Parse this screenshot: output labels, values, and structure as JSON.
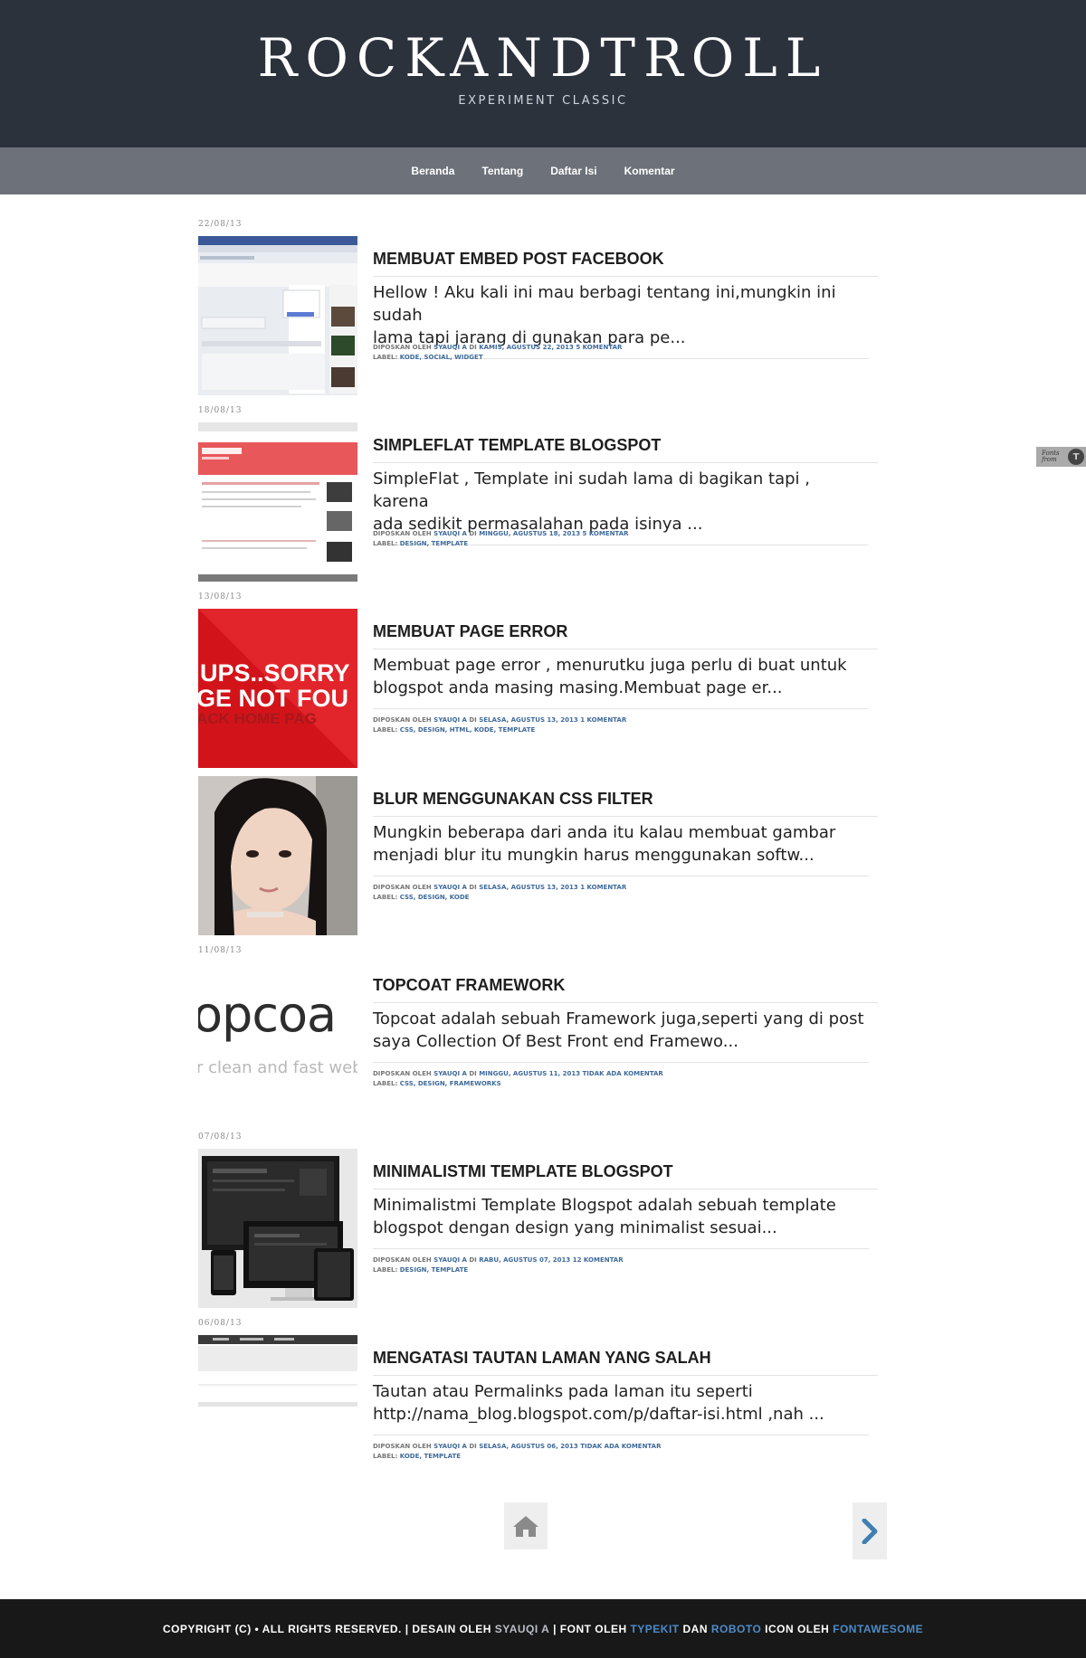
{
  "header": {
    "title": "ROCKANDTROLL",
    "subtitle": "EXPERIMENT CLASSIC"
  },
  "nav": {
    "items": [
      "Beranda",
      "Tentang",
      "Daftar Isi",
      "Komentar"
    ]
  },
  "meta_labels": {
    "posted_by": "Diposkan oleh",
    "at": "di",
    "label": "Label:"
  },
  "posts": [
    {
      "date": "22/08/13",
      "title": "Membuat Embed Post Facebook",
      "excerpt_line1": "Hellow ! Aku kali ini mau berbagi tentang ini,mungkin ini sudah",
      "excerpt_line2": "lama tapi jarang di gunakan para pe...",
      "author": "Syauqi A",
      "timestamp": "Kamis, Agustus 22, 2013",
      "comments": "5 komentar",
      "labels": "Kode, Social, Widget"
    },
    {
      "date": "18/08/13",
      "title": "SimpleFlat Template Blogspot",
      "excerpt_line1": "SimpleFlat , Template ini sudah lama di bagikan tapi , karena",
      "excerpt_line2": "ada sedikit permasalahan pada isinya ...",
      "author": "Syauqi A",
      "timestamp": "Minggu, Agustus 18, 2013",
      "comments": "5 komentar",
      "labels": "Design, Template"
    },
    {
      "date": "13/08/13",
      "title": "Membuat Page Error",
      "excerpt_line1": "Membuat page error , menurutku juga perlu di buat untuk",
      "excerpt_line2": "blogspot anda masing masing.Membuat page er...",
      "author": "Syauqi A",
      "timestamp": "Selasa, Agustus 13, 2013",
      "comments": "1 komentar",
      "labels": "Css, Design, Html, Kode, Template",
      "thumb_text1": "UPS..SORRY",
      "thumb_text2": "GE NOT FOU",
      "thumb_text3": "ACK HOME PAG"
    },
    {
      "date": "",
      "title": "Blur Menggunakan CSS Filter",
      "excerpt_line1": "Mungkin beberapa dari anda itu kalau membuat gambar",
      "excerpt_line2": "menjadi blur itu mungkin harus menggunakan softw...",
      "author": "Syauqi A",
      "timestamp": "Selasa, Agustus 13, 2013",
      "comments": "1 komentar",
      "labels": "Css, Design, Kode"
    },
    {
      "date": "11/08/13",
      "title": "Topcoat Framework",
      "excerpt_line1": "Topcoat adalah sebuah Framework juga,seperti yang di post",
      "excerpt_line2": "saya Collection Of Best Front end Framewo...",
      "author": "Syauqi A",
      "timestamp": "Minggu, Agustus 11, 2013",
      "comments": "Tidak ada komentar",
      "labels": "Css, Design, Frameworks",
      "thumb_text1": "opcoa",
      "thumb_text2": "r clean and fast web"
    },
    {
      "date": "07/08/13",
      "title": "MinimalistMi Template Blogspot",
      "excerpt_line1": "Minimalistmi Template Blogspot adalah sebuah template",
      "excerpt_line2": "blogspot dengan design yang minimalist sesuai...",
      "author": "Syauqi A",
      "timestamp": "Rabu, Agustus 07, 2013",
      "comments": "12 komentar",
      "labels": "Design, Template"
    },
    {
      "date": "06/08/13",
      "title": "Mengatasi Tautan Laman Yang Salah",
      "excerpt_line1": "Tautan atau Permalinks pada laman itu seperti",
      "excerpt_line2": "http://nama_blog.blogspot.com/p/daftar-isi.html ,nah ...",
      "author": "Syauqi A",
      "timestamp": "Selasa, Agustus 06, 2013",
      "comments": "Tidak ada komentar",
      "labels": "Kode, Template"
    }
  ],
  "pager": {
    "home_icon": "home-icon",
    "next_icon": "chevron-right-icon"
  },
  "fonts_widget": {
    "text": "Fonts from",
    "logo": "T"
  },
  "footer": {
    "copyright": "Copyright (c) • All Rights Reserved. | Desain oleh",
    "designer": "Syauqi A",
    "font_by": "| Font oleh",
    "typekit": "Typekit",
    "and": "dan",
    "roboto": "Roboto",
    "icon_by": "Icon oleh",
    "fontawesome": "FontAwesome"
  },
  "colors": {
    "header_bg": "#2b323c",
    "nav_bg": "#6d7179",
    "link": "#3f6a9a",
    "footer_bg": "#181818",
    "footer_link": "#4d8bc7"
  }
}
